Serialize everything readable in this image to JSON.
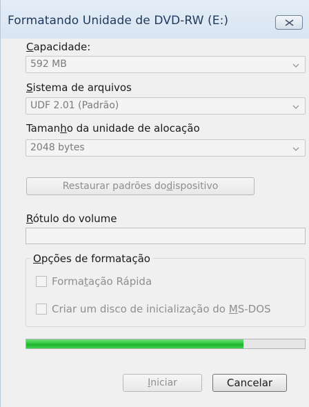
{
  "window": {
    "title": "Formatando Unidade de DVD-RW (E:)"
  },
  "capacity": {
    "label_pre": "",
    "label_key": "C",
    "label_post": "apacidade:",
    "value": "592 MB"
  },
  "filesystem": {
    "label_pre": "",
    "label_key": "S",
    "label_post": "istema de arquivos",
    "value": "UDF 2.01 (Padrão)"
  },
  "allocation": {
    "label_pre": "Taman",
    "label_key": "h",
    "label_post": "o da unidade de alocação",
    "value": "2048 bytes"
  },
  "restore_button": {
    "label_pre": "Restaurar padrões do ",
    "label_key": "d",
    "label_post": "ispositivo"
  },
  "volume_label": {
    "label_pre": "",
    "label_key": "R",
    "label_post": "ótulo do volume",
    "value": ""
  },
  "format_options": {
    "title_pre": "",
    "title_key": "O",
    "title_post": "pções de formatação",
    "quick_pre": "Forma",
    "quick_key": "t",
    "quick_post": "ação Rápida",
    "msdos_pre": "Criar um disco de inicialização do ",
    "msdos_key": "M",
    "msdos_post": "S-DOS"
  },
  "progress": {
    "fraction": 0.78
  },
  "buttons": {
    "start_pre": "",
    "start_key": "I",
    "start_post": "niciar",
    "cancel": "Cancelar"
  },
  "colors": {
    "progress_green": "#2fca3c",
    "title_text": "#1e395b"
  },
  "icons": {
    "close": "close-icon",
    "dropdown": "chevron-down-icon"
  }
}
